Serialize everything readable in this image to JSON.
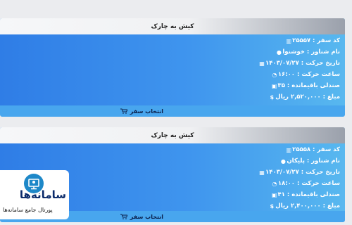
{
  "trips": [
    {
      "title": "کیش به چارک",
      "code": "کد سفر : ۲۵۵۵۷",
      "ship": "نام شناور : خوشنوا",
      "date": "تاریخ حرکت : ۱۴۰۳/۰۷/۲۷",
      "time": "ساعت حرکت : ۱۶:۰۰",
      "seats": "صندلی باقیمانده : ۳۵",
      "price": "مبلغ : ۲,۵۲۰,۰۰۰ ریال",
      "select_label": "انتخاب سفر"
    },
    {
      "title": "کیش به چارک",
      "code": "کد سفر : ۲۵۵۵۸",
      "ship": "نام شناور : پلیکان",
      "date": "تاریخ حرکت : ۱۴۰۳/۰۷/۲۷",
      "time": "ساعت حرکت : ۱۸:۰۰",
      "seats": "صندلی باقیمانده : ۴۱",
      "price": "مبلغ : ۲,۴۰۰,۰۰۰ ریال",
      "select_label": "انتخاب سفر"
    }
  ],
  "logo": {
    "name": "سامانه‌ها",
    "tagline": "پورتال جامع سامانه‌ها"
  },
  "icons": [
    "barcode-icon",
    "user-icon",
    "calendar-icon",
    "clock-icon",
    "seat-icon",
    "dollar-icon",
    "cart-icon"
  ]
}
